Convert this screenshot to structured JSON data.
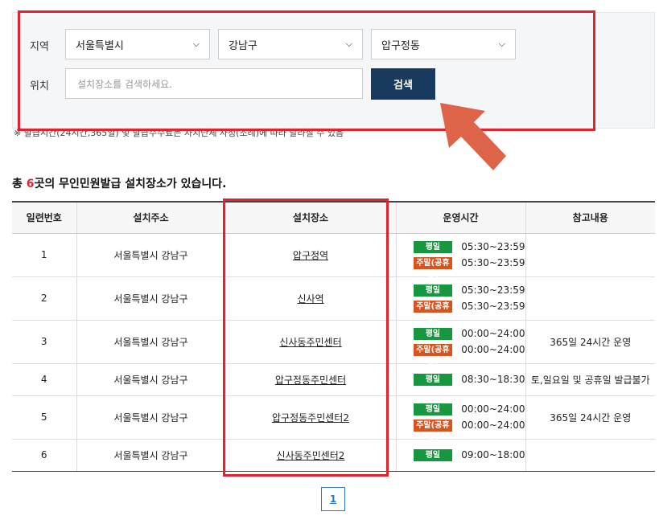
{
  "search": {
    "region_label": "지역",
    "location_label": "위치",
    "city": "서울특별시",
    "district": "강남구",
    "dong": "압구정동",
    "placeholder": "설치장소를 검색하세요.",
    "button": "검색"
  },
  "note": "※ 발급시간(24시간,365일) 및 발급수수료는 자치단체 사정(조례)에 따라 달라질 수 있음",
  "summary": {
    "prefix": "총 ",
    "count": "6",
    "suffix": "곳의 무인민원발급 설치장소가 있습니다."
  },
  "table": {
    "headers": [
      "일련번호",
      "설치주소",
      "설치장소",
      "운영시간",
      "참고내용"
    ],
    "rows": [
      {
        "no": "1",
        "address": "서울특별시 강남구",
        "place": "압구정역",
        "hours": [
          {
            "type": "평일",
            "time": "05:30~23:59"
          },
          {
            "type": "주말(공휴일)",
            "time": "05:30~23:59"
          }
        ],
        "remark": ""
      },
      {
        "no": "2",
        "address": "서울특별시 강남구",
        "place": "신사역",
        "hours": [
          {
            "type": "평일",
            "time": "05:30~23:59"
          },
          {
            "type": "주말(공휴일)",
            "time": "05:30~23:59"
          }
        ],
        "remark": ""
      },
      {
        "no": "3",
        "address": "서울특별시 강남구",
        "place": "신사동주민센터",
        "hours": [
          {
            "type": "평일",
            "time": "00:00~24:00"
          },
          {
            "type": "주말(공휴일)",
            "time": "00:00~24:00"
          }
        ],
        "remark": "365일 24시간 운영"
      },
      {
        "no": "4",
        "address": "서울특별시 강남구",
        "place": "압구정동주민센터",
        "hours": [
          {
            "type": "평일",
            "time": "08:30~18:30"
          }
        ],
        "remark": "토,일요일 및 공휴일 발급불가"
      },
      {
        "no": "5",
        "address": "서울특별시 강남구",
        "place": "압구정동주민센터2",
        "hours": [
          {
            "type": "평일",
            "time": "00:00~24:00"
          },
          {
            "type": "주말(공휴일)",
            "time": "00:00~24:00"
          }
        ],
        "remark": "365일 24시간 운영"
      },
      {
        "no": "6",
        "address": "서울특별시 강남구",
        "place": "신사동주민센터2",
        "hours": [
          {
            "type": "평일",
            "time": "09:00~18:00"
          }
        ],
        "remark": ""
      }
    ]
  },
  "pagination": {
    "current": "1"
  },
  "colors": {
    "highlight": "#e1232f",
    "arrow": "#dd6448",
    "weekday_badge": "#17973f",
    "weekend_badge": "#d9531f",
    "button": "#173a5e"
  }
}
